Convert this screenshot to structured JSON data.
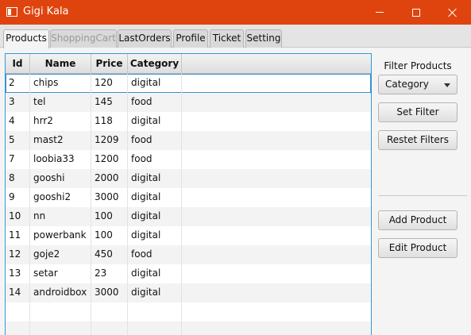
{
  "window": {
    "title": "Gigi Kala"
  },
  "tabs": [
    {
      "label": "Products"
    },
    {
      "label": "ShoppingCart"
    },
    {
      "label": "LastOrders"
    },
    {
      "label": "Profile"
    },
    {
      "label": "Ticket"
    },
    {
      "label": "Setting"
    }
  ],
  "table": {
    "headers": {
      "id": "Id",
      "name": "Name",
      "price": "Price",
      "category": "Category"
    },
    "rows": [
      {
        "id": "2",
        "name": "chips",
        "price": "120",
        "category": "digital"
      },
      {
        "id": "3",
        "name": "tel",
        "price": "145",
        "category": "food"
      },
      {
        "id": "4",
        "name": "hrr2",
        "price": "118",
        "category": "digital"
      },
      {
        "id": "5",
        "name": "mast2",
        "price": "1209",
        "category": "food"
      },
      {
        "id": "7",
        "name": "loobia33",
        "price": "1200",
        "category": "food"
      },
      {
        "id": "8",
        "name": "gooshi",
        "price": "2000",
        "category": "digital"
      },
      {
        "id": "9",
        "name": "gooshi2",
        "price": "3000",
        "category": "digital"
      },
      {
        "id": "10",
        "name": "nn",
        "price": "100",
        "category": "digital"
      },
      {
        "id": "11",
        "name": "powerbank",
        "price": "100",
        "category": "digital"
      },
      {
        "id": "12",
        "name": "goje2",
        "price": "450",
        "category": "food"
      },
      {
        "id": "13",
        "name": "setar",
        "price": "23",
        "category": "digital"
      },
      {
        "id": "14",
        "name": "androidbox",
        "price": "3000",
        "category": "digital"
      }
    ]
  },
  "filter": {
    "label": "Filter Products",
    "combo_value": "Category",
    "set_filter_label": "Set Filter",
    "reset_filters_label": "Restet Filters"
  },
  "actions": {
    "add_label": "Add Product",
    "edit_label": "Edit Product"
  },
  "colors": {
    "titlebar": "#e0440e",
    "selection_border": "#2e9bd6"
  },
  "icons": [
    "app-window-icon",
    "minimize-icon",
    "maximize-icon",
    "close-icon",
    "chevron-down-icon"
  ]
}
